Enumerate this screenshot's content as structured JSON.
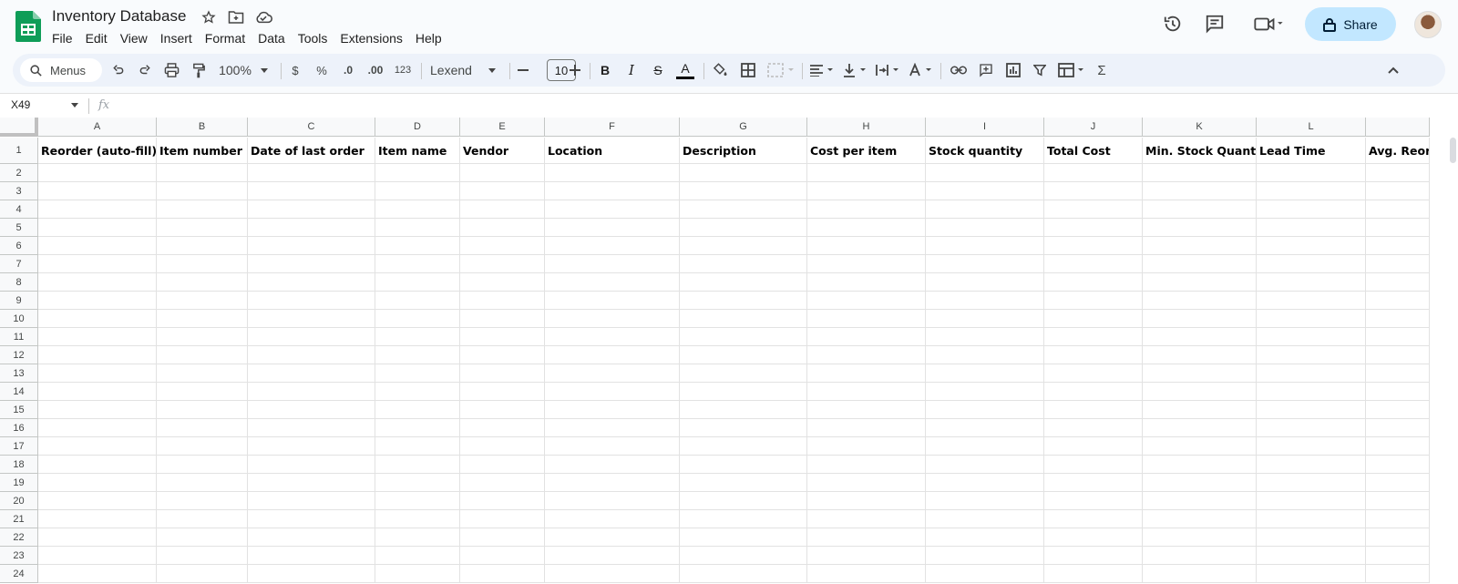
{
  "app": {
    "title": "Inventory Database",
    "menu": [
      "File",
      "Edit",
      "View",
      "Insert",
      "Format",
      "Data",
      "Tools",
      "Extensions",
      "Help"
    ],
    "share_label": "Share"
  },
  "toolbar": {
    "search_label": "Menus",
    "zoom": "100%",
    "currency": "$",
    "percent": "%",
    "dec_decrease": ".0",
    "dec_increase": ".00",
    "number_format": "123",
    "font": "Lexend",
    "font_size": "10",
    "bold": "B",
    "italic": "I",
    "strike": "S",
    "text_color": "A",
    "sum": "Σ"
  },
  "formula_bar": {
    "cell_ref": "X49",
    "fx": "fx"
  },
  "sheet": {
    "columns": [
      "A",
      "B",
      "C",
      "D",
      "E",
      "F",
      "G",
      "H",
      "I",
      "J",
      "K",
      "L",
      ""
    ],
    "headers": [
      "Reorder (auto-fill)",
      "Item number",
      "Date of last order",
      "Item name",
      "Vendor",
      "Location",
      "Description",
      "Cost per item",
      "Stock quantity",
      "Total Cost",
      "Min. Stock Quantity",
      "Lead Time",
      "Avg. Reor"
    ],
    "rows": [
      "1",
      "2",
      "3",
      "4",
      "5",
      "6",
      "7",
      "8",
      "9",
      "10",
      "11",
      "12",
      "13",
      "14",
      "15",
      "16",
      "17",
      "18",
      "19",
      "20",
      "21",
      "22",
      "23",
      "24"
    ]
  },
  "colors": {
    "accent": "#c2e7ff",
    "sheets_green": "#0f9d58"
  }
}
